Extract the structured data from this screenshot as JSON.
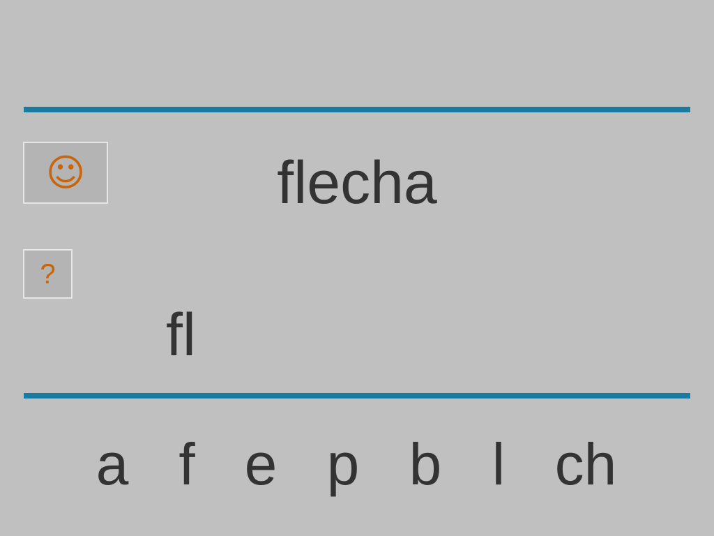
{
  "buttons": {
    "smiley": {
      "icon": "smiley-face-icon",
      "glyph": "☺"
    },
    "help": {
      "icon": "question-mark-icon",
      "glyph": "?"
    }
  },
  "target_word": "flecha",
  "answer": "fl",
  "letters": [
    "a",
    "f",
    "e",
    "p",
    "b",
    "l",
    "ch"
  ],
  "colors": {
    "background": "#c0c0c0",
    "rule": "#1a7aa0",
    "button_glyph": "#c8640a",
    "text": "#333333"
  }
}
